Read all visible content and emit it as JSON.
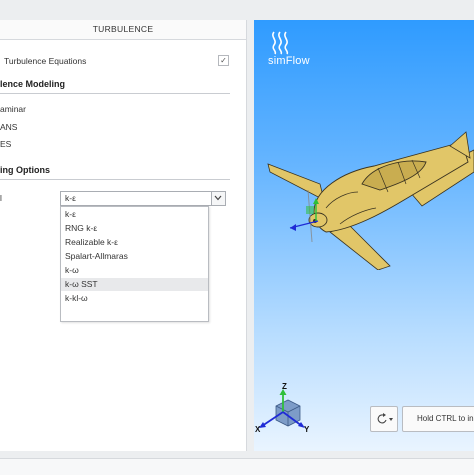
{
  "panel": {
    "title": "TURBULENCE",
    "turbulence_equations_label": "Turbulence Equations",
    "turbulence_equations_checked": true,
    "turbulence_modeling_title": "lence Modeling",
    "modeling_options": [
      "aminar",
      "ANS",
      "ES"
    ],
    "options_title": "ing Options",
    "model_label": "l",
    "model_value": "k-ε"
  },
  "dropdown": {
    "options": [
      "k-ε",
      "RNG k-ε",
      "Realizable k-ε",
      "Spalart-Allmaras",
      "k-ω",
      "k-ω SST",
      "k-kl-ω"
    ],
    "selected_index": 5
  },
  "viewport": {
    "logo_text": "simFlow",
    "axis_labels": {
      "z": "Z",
      "x": "X",
      "y": "Y"
    },
    "hint": "Hold CTRL to in",
    "colors": {
      "model": "#e1c668",
      "x_axis": "#1f2bd6",
      "y_axis": "#1f2bd6",
      "z_axis": "#2fbf3a",
      "box": "#6a8bb7"
    }
  }
}
